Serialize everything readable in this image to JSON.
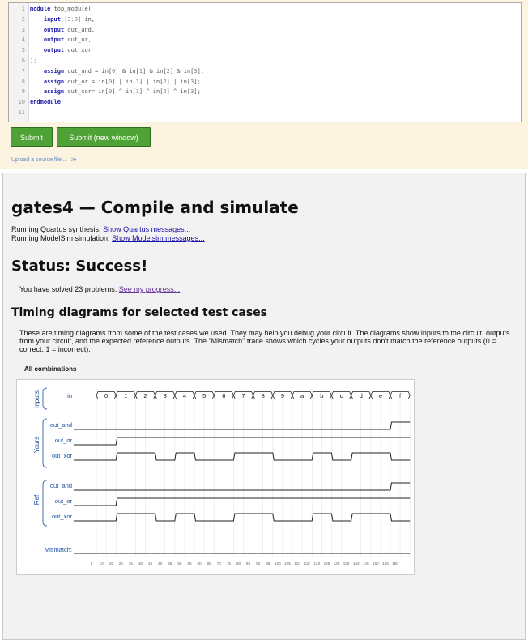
{
  "editor": {
    "line_numbers": [
      "1",
      "2",
      "3",
      "4",
      "5",
      "6",
      "7",
      "8",
      "9",
      "10",
      "11"
    ],
    "lines": [
      [
        {
          "t": "module",
          "k": "kw"
        },
        {
          "t": " top_module("
        }
      ],
      [
        {
          "t": "    "
        },
        {
          "t": "input",
          "k": "kw"
        },
        {
          "t": " "
        },
        {
          "t": "[3:0]",
          "k": "num"
        },
        {
          "t": " in,"
        }
      ],
      [
        {
          "t": "    "
        },
        {
          "t": "output",
          "k": "kw"
        },
        {
          "t": " out_and,"
        }
      ],
      [
        {
          "t": "    "
        },
        {
          "t": "output",
          "k": "kw"
        },
        {
          "t": " out_or,"
        }
      ],
      [
        {
          "t": "    "
        },
        {
          "t": "output",
          "k": "kw"
        },
        {
          "t": " out_xor"
        }
      ],
      [
        {
          "t": ");"
        }
      ],
      [
        {
          "t": "    "
        },
        {
          "t": "assign",
          "k": "kw"
        },
        {
          "t": " out_and = in["
        },
        {
          "t": "0",
          "k": "num"
        },
        {
          "t": "] & in["
        },
        {
          "t": "1",
          "k": "num"
        },
        {
          "t": "] & in["
        },
        {
          "t": "2",
          "k": "num"
        },
        {
          "t": "] & in["
        },
        {
          "t": "3",
          "k": "num"
        },
        {
          "t": "];"
        }
      ],
      [
        {
          "t": "    "
        },
        {
          "t": "assign",
          "k": "kw"
        },
        {
          "t": " out_or = in["
        },
        {
          "t": "0",
          "k": "num"
        },
        {
          "t": "] | in["
        },
        {
          "t": "1",
          "k": "num"
        },
        {
          "t": "] | in["
        },
        {
          "t": "2",
          "k": "num"
        },
        {
          "t": "] | in["
        },
        {
          "t": "3",
          "k": "num"
        },
        {
          "t": "];"
        }
      ],
      [
        {
          "t": "    "
        },
        {
          "t": "assign",
          "k": "kw"
        },
        {
          "t": " out_xor= in["
        },
        {
          "t": "0",
          "k": "num"
        },
        {
          "t": "] ^ in["
        },
        {
          "t": "1",
          "k": "num"
        },
        {
          "t": "] ^ in["
        },
        {
          "t": "2",
          "k": "num"
        },
        {
          "t": "] ^ in["
        },
        {
          "t": "3",
          "k": "num"
        },
        {
          "t": "];"
        }
      ],
      [
        {
          "t": "endmodule",
          "k": "kw"
        }
      ],
      []
    ]
  },
  "buttons": {
    "submit": "Submit",
    "submit_new": "Submit (new window)"
  },
  "upload": {
    "label": "Upload a source file...",
    "chevron": "≫"
  },
  "result": {
    "title": "gates4 — Compile and simulate",
    "quartus_text": "Running Quartus synthesis.",
    "quartus_link": "Show Quartus messages...",
    "modelsim_text": "Running ModelSim simulation.",
    "modelsim_link": "Show Modelsim messages...",
    "status": "Status: Success!",
    "solved_text": "You have solved 23 problems.",
    "progress_link": "See my progress...",
    "timing_heading": "Timing diagrams for selected test cases",
    "description": "These are timing diagrams from some of the test cases we used. They may help you debug your circuit. The diagrams show inputs to the circuit, outputs from your circuit, and the expected reference outputs. The \"Mismatch\" trace shows which cycles your outputs don't match the reference outputs (0 = correct, 1 = incorrect).",
    "combo_title": "All combinations"
  },
  "waveform": {
    "group_labels": {
      "inputs": "Inputs",
      "yours": "Yours",
      "ref": "Ref"
    },
    "in_label": "in",
    "in_values": [
      "0",
      "1",
      "2",
      "3",
      "4",
      "5",
      "6",
      "7",
      "8",
      "9",
      "a",
      "b",
      "c",
      "d",
      "e",
      "f"
    ],
    "yours": [
      {
        "name": "out_and",
        "values": [
          0,
          0,
          0,
          0,
          0,
          0,
          0,
          0,
          0,
          0,
          0,
          0,
          0,
          0,
          0,
          1
        ]
      },
      {
        "name": "out_or",
        "values": [
          0,
          1,
          1,
          1,
          1,
          1,
          1,
          1,
          1,
          1,
          1,
          1,
          1,
          1,
          1,
          1
        ]
      },
      {
        "name": "out_xor",
        "values": [
          0,
          1,
          1,
          0,
          1,
          0,
          0,
          1,
          1,
          0,
          0,
          1,
          0,
          1,
          1,
          0
        ]
      }
    ],
    "ref": [
      {
        "name": "out_and",
        "values": [
          0,
          0,
          0,
          0,
          0,
          0,
          0,
          0,
          0,
          0,
          0,
          0,
          0,
          0,
          0,
          1
        ]
      },
      {
        "name": "out_or",
        "values": [
          0,
          1,
          1,
          1,
          1,
          1,
          1,
          1,
          1,
          1,
          1,
          1,
          1,
          1,
          1,
          1
        ]
      },
      {
        "name": "out_xor",
        "values": [
          0,
          1,
          1,
          0,
          1,
          0,
          0,
          1,
          1,
          0,
          0,
          1,
          0,
          1,
          1,
          0
        ]
      }
    ],
    "mismatch_label": "Mismatch:",
    "mismatch_values": [
      0,
      0,
      0,
      0,
      0,
      0,
      0,
      0,
      0,
      0,
      0,
      0,
      0,
      0,
      0,
      0
    ],
    "time_ticks": [
      "5",
      "10",
      "15",
      "20",
      "25",
      "30",
      "35",
      "40",
      "45",
      "50",
      "55",
      "60",
      "65",
      "70",
      "75",
      "80",
      "85",
      "90",
      "95",
      "100",
      "105",
      "110",
      "115",
      "120",
      "125",
      "130",
      "135",
      "140",
      "145",
      "150",
      "155",
      "160"
    ],
    "colors": {
      "signal": "#222222",
      "label": "#1a4fa0",
      "grid": "#e6e6e6"
    }
  }
}
